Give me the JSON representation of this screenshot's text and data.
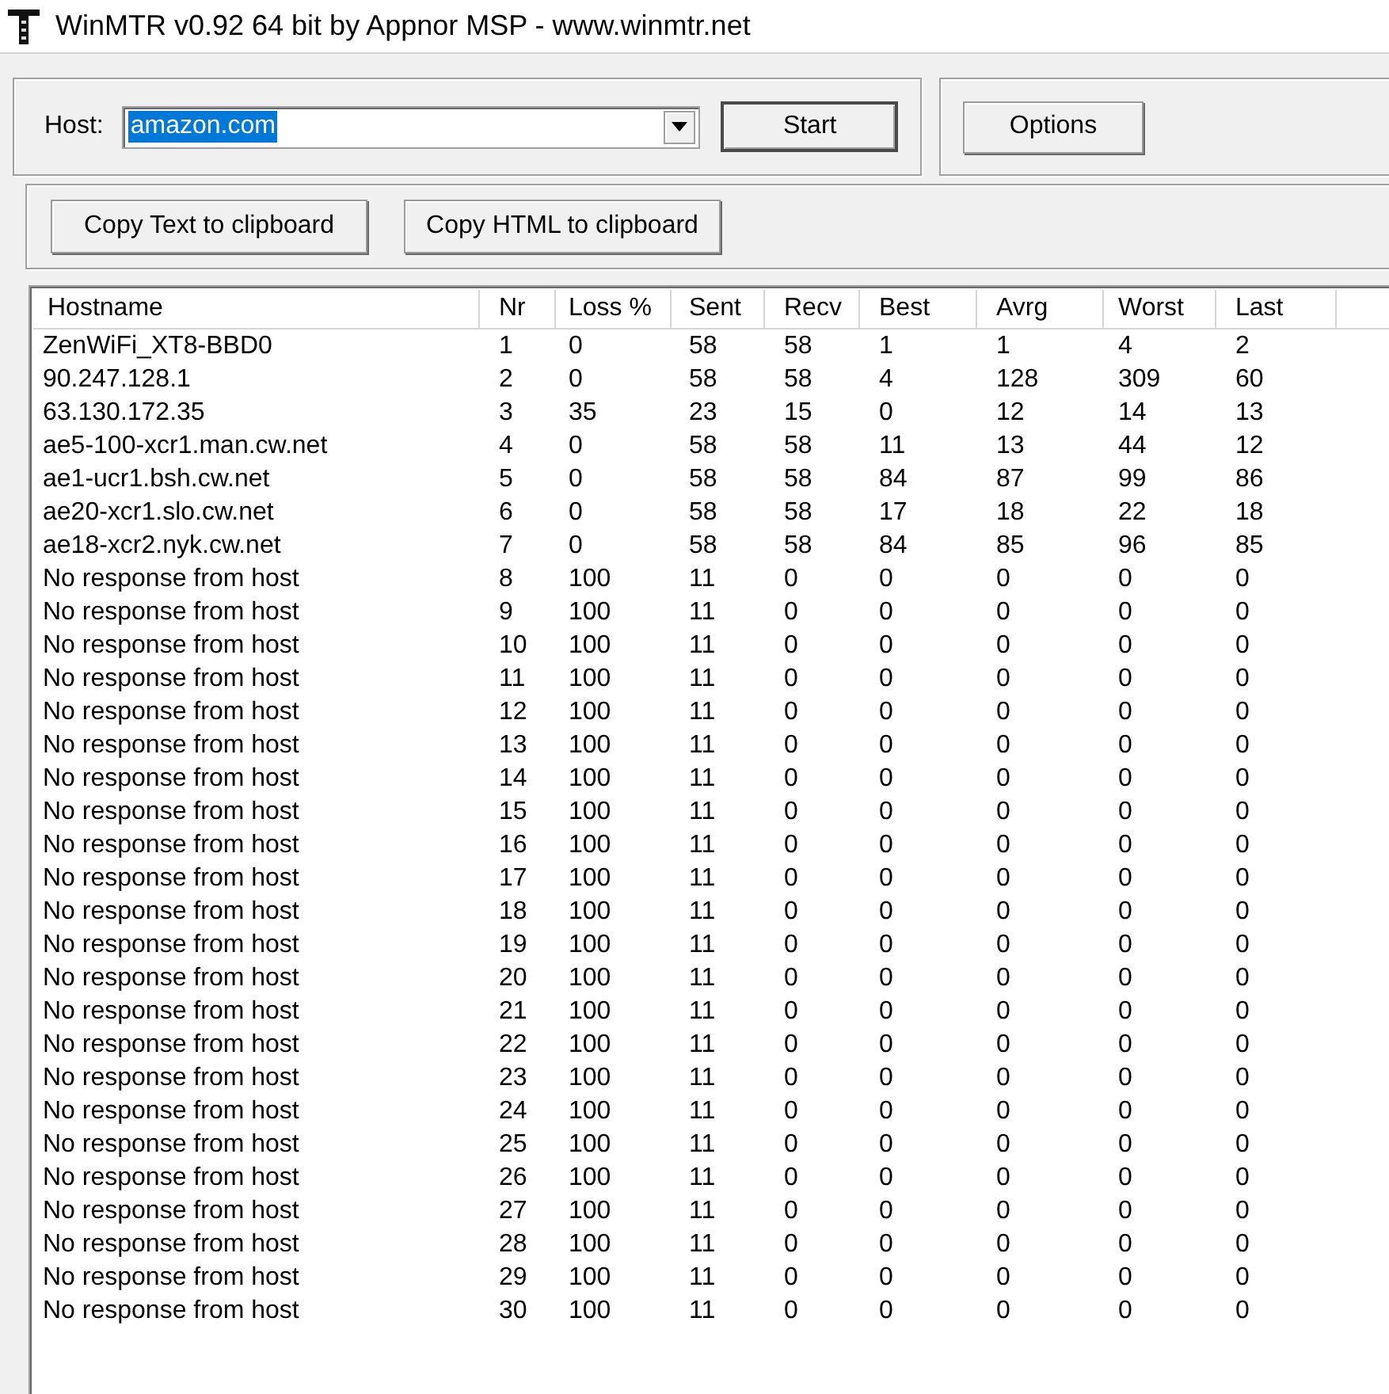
{
  "window": {
    "title": "WinMTR v0.92 64 bit by Appnor MSP - www.winmtr.net"
  },
  "host": {
    "label": "Host:",
    "value": "amazon.com",
    "text_selected": true
  },
  "start_button": {
    "label": "Start",
    "default": true
  },
  "options_button": {
    "label": "Options",
    "default": false
  },
  "copy_buttons": [
    "Copy Text to clipboard",
    "Copy HTML to clipboard"
  ],
  "table": {
    "columns": [
      "Hostname",
      "Nr",
      "Loss %",
      "Sent",
      "Recv",
      "Best",
      "Avrg",
      "Worst",
      "Last"
    ],
    "rows": [
      [
        "ZenWiFi_XT8-BBD0",
        "1",
        "0",
        "58",
        "58",
        "1",
        "1",
        "4",
        "2"
      ],
      [
        "90.247.128.1",
        "2",
        "0",
        "58",
        "58",
        "4",
        "128",
        "309",
        "60"
      ],
      [
        "63.130.172.35",
        "3",
        "35",
        "23",
        "15",
        "0",
        "12",
        "14",
        "13"
      ],
      [
        "ae5-100-xcr1.man.cw.net",
        "4",
        "0",
        "58",
        "58",
        "11",
        "13",
        "44",
        "12"
      ],
      [
        "ae1-ucr1.bsh.cw.net",
        "5",
        "0",
        "58",
        "58",
        "84",
        "87",
        "99",
        "86"
      ],
      [
        "ae20-xcr1.slo.cw.net",
        "6",
        "0",
        "58",
        "58",
        "17",
        "18",
        "22",
        "18"
      ],
      [
        "ae18-xcr2.nyk.cw.net",
        "7",
        "0",
        "58",
        "58",
        "84",
        "85",
        "96",
        "85"
      ],
      [
        "No response from host",
        "8",
        "100",
        "11",
        "0",
        "0",
        "0",
        "0",
        "0"
      ],
      [
        "No response from host",
        "9",
        "100",
        "11",
        "0",
        "0",
        "0",
        "0",
        "0"
      ],
      [
        "No response from host",
        "10",
        "100",
        "11",
        "0",
        "0",
        "0",
        "0",
        "0"
      ],
      [
        "No response from host",
        "11",
        "100",
        "11",
        "0",
        "0",
        "0",
        "0",
        "0"
      ],
      [
        "No response from host",
        "12",
        "100",
        "11",
        "0",
        "0",
        "0",
        "0",
        "0"
      ],
      [
        "No response from host",
        "13",
        "100",
        "11",
        "0",
        "0",
        "0",
        "0",
        "0"
      ],
      [
        "No response from host",
        "14",
        "100",
        "11",
        "0",
        "0",
        "0",
        "0",
        "0"
      ],
      [
        "No response from host",
        "15",
        "100",
        "11",
        "0",
        "0",
        "0",
        "0",
        "0"
      ],
      [
        "No response from host",
        "16",
        "100",
        "11",
        "0",
        "0",
        "0",
        "0",
        "0"
      ],
      [
        "No response from host",
        "17",
        "100",
        "11",
        "0",
        "0",
        "0",
        "0",
        "0"
      ],
      [
        "No response from host",
        "18",
        "100",
        "11",
        "0",
        "0",
        "0",
        "0",
        "0"
      ],
      [
        "No response from host",
        "19",
        "100",
        "11",
        "0",
        "0",
        "0",
        "0",
        "0"
      ],
      [
        "No response from host",
        "20",
        "100",
        "11",
        "0",
        "0",
        "0",
        "0",
        "0"
      ],
      [
        "No response from host",
        "21",
        "100",
        "11",
        "0",
        "0",
        "0",
        "0",
        "0"
      ],
      [
        "No response from host",
        "22",
        "100",
        "11",
        "0",
        "0",
        "0",
        "0",
        "0"
      ],
      [
        "No response from host",
        "23",
        "100",
        "11",
        "0",
        "0",
        "0",
        "0",
        "0"
      ],
      [
        "No response from host",
        "24",
        "100",
        "11",
        "0",
        "0",
        "0",
        "0",
        "0"
      ],
      [
        "No response from host",
        "25",
        "100",
        "11",
        "0",
        "0",
        "0",
        "0",
        "0"
      ],
      [
        "No response from host",
        "26",
        "100",
        "11",
        "0",
        "0",
        "0",
        "0",
        "0"
      ],
      [
        "No response from host",
        "27",
        "100",
        "11",
        "0",
        "0",
        "0",
        "0",
        "0"
      ],
      [
        "No response from host",
        "28",
        "100",
        "11",
        "0",
        "0",
        "0",
        "0",
        "0"
      ],
      [
        "No response from host",
        "29",
        "100",
        "11",
        "0",
        "0",
        "0",
        "0",
        "0"
      ],
      [
        "No response from host",
        "30",
        "100",
        "11",
        "0",
        "0",
        "0",
        "0",
        "0"
      ]
    ]
  }
}
